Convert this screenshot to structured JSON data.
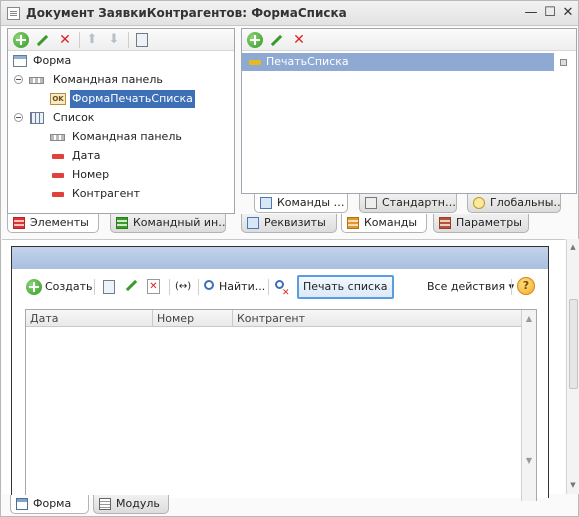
{
  "window": {
    "title": "Документ ЗаявкиКонтрагентов: ФормаСписка",
    "controls": [
      "—",
      "☐",
      "✕"
    ]
  },
  "elements_panel": {
    "toolbar": [
      {
        "icon": "add-icon"
      },
      {
        "icon": "edit-icon"
      },
      {
        "icon": "delete-icon"
      },
      {
        "icon": "move-up-icon"
      },
      {
        "icon": "move-down-icon"
      },
      {
        "icon": "properties-icon"
      }
    ],
    "tree": [
      {
        "label": "Форма",
        "icon": "form-icon"
      },
      {
        "label": "Командная панель",
        "icon": "command-panel-icon"
      },
      {
        "label": "ФормаПечатьСписка",
        "icon": "button-icon"
      },
      {
        "label": "Список",
        "icon": "table-icon"
      },
      {
        "label": "Командная панель",
        "icon": "command-panel-icon"
      },
      {
        "label": "Дата",
        "icon": "field-icon"
      },
      {
        "label": "Номер",
        "icon": "field-icon"
      },
      {
        "label": "Контрагент",
        "icon": "field-icon"
      }
    ],
    "tabs": [
      {
        "label": "Элементы",
        "icon": "elements-icon"
      },
      {
        "label": "Командный ин…",
        "icon": "command-interface-icon"
      }
    ]
  },
  "commands_panel": {
    "toolbar": [
      {
        "icon": "add-icon"
      },
      {
        "icon": "edit-icon"
      },
      {
        "icon": "delete-icon"
      }
    ],
    "items": [
      {
        "label": "ПечатьСписка",
        "icon": "command-icon"
      }
    ],
    "tabs": [
      {
        "label": "Команды …",
        "icon": "form-commands-icon"
      },
      {
        "label": "Стандартн…",
        "icon": "standard-commands-icon"
      },
      {
        "label": "Глобальны…",
        "icon": "global-commands-icon"
      }
    ]
  },
  "middle_tabs": [
    {
      "label": "Реквизиты",
      "icon": "attributes-icon"
    },
    {
      "label": "Команды",
      "icon": "commands-icon"
    },
    {
      "label": "Параметры",
      "icon": "parameters-icon"
    }
  ],
  "preview": {
    "toolbar": {
      "create_label": "Создать",
      "find_label": "Найти...",
      "print_list_label": "Печать списка",
      "all_actions_label": "Все действия ▾",
      "help_label": "?"
    },
    "columns": [
      "Дата",
      "Номер",
      "Контрагент"
    ]
  },
  "bottom_tabs": [
    {
      "label": "Форма",
      "icon": "form-tab-icon"
    },
    {
      "label": "Модуль",
      "icon": "module-tab-icon"
    }
  ],
  "colors": {
    "selection": "#8eaad3",
    "selected_label": "#3d6fb6",
    "print_button_border": "#5b9be0"
  }
}
